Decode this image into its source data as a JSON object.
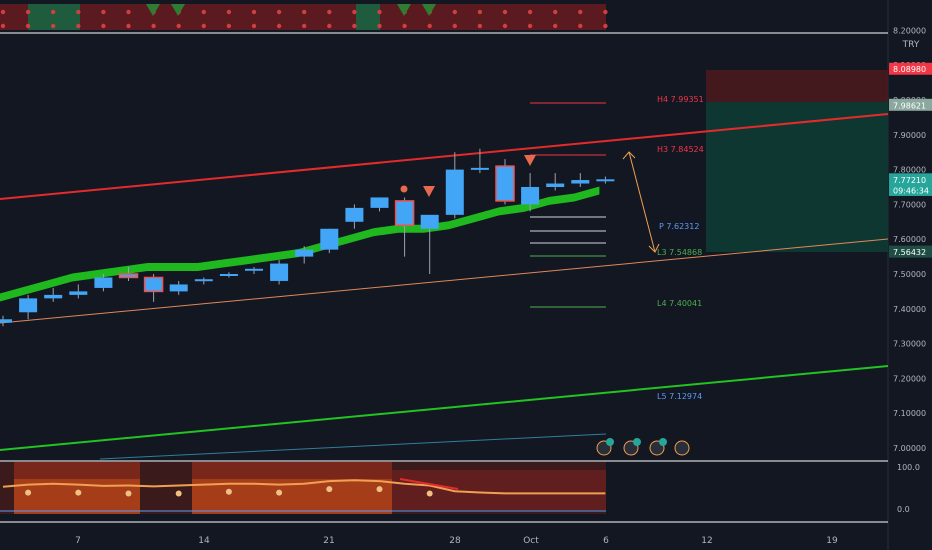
{
  "currency": "TRY",
  "price_axis": {
    "ticks": [
      "8.20000",
      "8.10000",
      "8.00000",
      "7.90000",
      "7.80000",
      "7.70000",
      "7.60000",
      "7.50000",
      "7.40000",
      "7.30000",
      "7.20000",
      "7.10000",
      "7.00000"
    ],
    "tick_values": [
      8.2,
      8.1,
      8.0,
      7.9,
      7.8,
      7.7,
      7.6,
      7.5,
      7.4,
      7.3,
      7.2,
      7.1,
      7.0
    ],
    "badges": [
      {
        "id": "stop",
        "text": "8.08980",
        "value": 8.0898,
        "bg": "#f23645",
        "fg": "#ffffff"
      },
      {
        "id": "target",
        "text": "7.98621",
        "value": 7.98621,
        "bg": "#8aa89e",
        "fg": "#ffffff"
      },
      {
        "id": "last",
        "text": "7.77210",
        "value": 7.7721,
        "bg": "#26a69a",
        "fg": "#ffffff"
      },
      {
        "id": "countdown",
        "text": "09:46:34",
        "value": 7.7415,
        "bg": "#26a69a",
        "fg": "#ffffff"
      },
      {
        "id": "entry",
        "text": "7.56432",
        "value": 7.56432,
        "bg": "#1f4d43",
        "fg": "#ffffff"
      }
    ]
  },
  "osc_axis": {
    "ticks": [
      "100.0",
      "0.0"
    ]
  },
  "time_axis": {
    "labels": [
      "7",
      "14",
      "21",
      "28",
      "Oct",
      "6",
      "12",
      "19"
    ]
  },
  "pivots": [
    {
      "label": "H4 7.99351",
      "value": 7.99351,
      "color": "#f23645"
    },
    {
      "label": "H3 7.84524",
      "value": 7.84524,
      "color": "#f23645"
    },
    {
      "label": "P 7.62312",
      "value": 7.62312,
      "color": "#5b9cf6"
    },
    {
      "label": "L3 7.54868",
      "value": 7.54868,
      "color": "#4caf50"
    },
    {
      "label": "L4 7.40041",
      "value": 7.40041,
      "color": "#4caf50"
    },
    {
      "label": "L5 7.12974",
      "value": 7.12974,
      "color": "#5b9cf6"
    }
  ],
  "chart_data": {
    "type": "candlestick",
    "symbol_currency": "TRY",
    "ylim": [
      7.0,
      8.2
    ],
    "up_color": "#42a5f5",
    "down_color": "#ef5350",
    "candles": [
      {
        "o": 7.36,
        "h": 7.38,
        "l": 7.35,
        "c": 7.37
      },
      {
        "o": 7.39,
        "h": 7.44,
        "l": 7.37,
        "c": 7.43
      },
      {
        "o": 7.43,
        "h": 7.46,
        "l": 7.42,
        "c": 7.44
      },
      {
        "o": 7.44,
        "h": 7.47,
        "l": 7.43,
        "c": 7.45
      },
      {
        "o": 7.46,
        "h": 7.5,
        "l": 7.45,
        "c": 7.49
      },
      {
        "o": 7.5,
        "h": 7.52,
        "l": 7.48,
        "c": 7.49
      },
      {
        "o": 7.49,
        "h": 7.5,
        "l": 7.42,
        "c": 7.45
      },
      {
        "o": 7.45,
        "h": 7.48,
        "l": 7.44,
        "c": 7.47
      },
      {
        "o": 7.48,
        "h": 7.49,
        "l": 7.47,
        "c": 7.485
      },
      {
        "o": 7.495,
        "h": 7.505,
        "l": 7.49,
        "c": 7.5
      },
      {
        "o": 7.51,
        "h": 7.52,
        "l": 7.5,
        "c": 7.515
      },
      {
        "o": 7.48,
        "h": 7.54,
        "l": 7.47,
        "c": 7.53
      },
      {
        "o": 7.55,
        "h": 7.58,
        "l": 7.53,
        "c": 7.57
      },
      {
        "o": 7.57,
        "h": 7.63,
        "l": 7.56,
        "c": 7.63
      },
      {
        "o": 7.65,
        "h": 7.7,
        "l": 7.63,
        "c": 7.69
      },
      {
        "o": 7.69,
        "h": 7.72,
        "l": 7.68,
        "c": 7.72
      },
      {
        "o": 7.71,
        "h": 7.72,
        "l": 7.55,
        "c": 7.64
      },
      {
        "o": 7.63,
        "h": 7.67,
        "l": 7.5,
        "c": 7.67
      },
      {
        "o": 7.67,
        "h": 7.85,
        "l": 7.66,
        "c": 7.8
      },
      {
        "o": 7.8,
        "h": 7.86,
        "l": 7.79,
        "c": 7.805
      },
      {
        "o": 7.81,
        "h": 7.83,
        "l": 7.7,
        "c": 7.71
      },
      {
        "o": 7.7,
        "h": 7.79,
        "l": 7.68,
        "c": 7.75
      },
      {
        "o": 7.75,
        "h": 7.79,
        "l": 7.74,
        "c": 7.76
      },
      {
        "o": 7.76,
        "h": 7.79,
        "l": 7.75,
        "c": 7.77
      },
      {
        "o": 7.77,
        "h": 7.78,
        "l": 7.76,
        "c": 7.7721
      }
    ],
    "band": [
      7.43,
      7.45,
      7.47,
      7.49,
      7.5,
      7.51,
      7.52,
      7.52,
      7.52,
      7.53,
      7.54,
      7.55,
      7.56,
      7.58,
      7.6,
      7.62,
      7.63,
      7.63,
      7.64,
      7.66,
      7.68,
      7.69,
      7.71,
      7.72,
      7.74
    ],
    "oscillator": {
      "range": [
        0,
        100
      ],
      "series": [
        55,
        60,
        62,
        60,
        57,
        58,
        56,
        58,
        60,
        62,
        62,
        60,
        62,
        68,
        70,
        68,
        62,
        58,
        45,
        42,
        40,
        40,
        40,
        40,
        40
      ]
    }
  }
}
